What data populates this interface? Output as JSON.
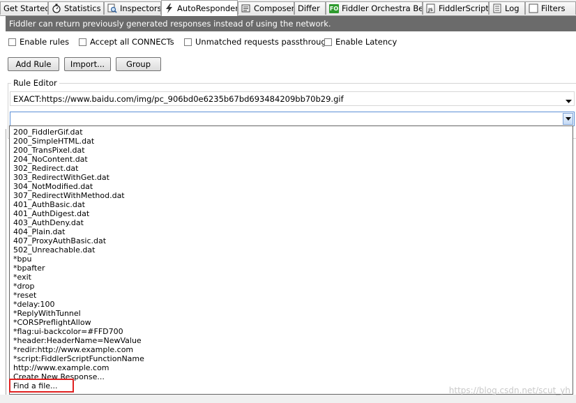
{
  "tabs": [
    {
      "label": "Get Started",
      "icon": ""
    },
    {
      "label": "Statistics",
      "icon": "stopwatch-icon"
    },
    {
      "label": "Inspectors",
      "icon": "inspect-icon"
    },
    {
      "label": "AutoResponder",
      "icon": "lightning-icon",
      "active": true
    },
    {
      "label": "Composer",
      "icon": "composer-icon"
    },
    {
      "label": "Differ",
      "icon": ""
    },
    {
      "label": "Fiddler Orchestra Beta",
      "icon": "fo-icon",
      "badge": "FO"
    },
    {
      "label": "FiddlerScript",
      "icon": "script-icon",
      "badge": "JS"
    },
    {
      "label": "Log",
      "icon": "log-icon"
    },
    {
      "label": "Filters",
      "icon": "filter-checkbox"
    }
  ],
  "info_bar": "Fiddler can return previously generated responses instead of using the network.",
  "options": {
    "enable_rules": "Enable rules",
    "accept_connects": "Accept all CONNECTs",
    "unmatched_passthrough": "Unmatched requests passthrough",
    "enable_latency": "Enable Latency"
  },
  "buttons": {
    "add_rule": "Add Rule",
    "import": "Import...",
    "group": "Group"
  },
  "rule_editor": {
    "title": "Rule Editor",
    "match_value": "EXACT:https://www.baidu.com/img/pc_906bd0e6235b67bd693484209bb70b29.gif",
    "action_value": ""
  },
  "dropdown_items": [
    "200_FiddlerGif.dat",
    "200_SimpleHTML.dat",
    "200_TransPixel.dat",
    "204_NoContent.dat",
    "302_Redirect.dat",
    "303_RedirectWithGet.dat",
    "304_NotModified.dat",
    "307_RedirectWithMethod.dat",
    "401_AuthBasic.dat",
    "401_AuthDigest.dat",
    "403_AuthDeny.dat",
    "404_Plain.dat",
    "407_ProxyAuthBasic.dat",
    "502_Unreachable.dat",
    "*bpu",
    "*bpafter",
    "*exit",
    "*drop",
    "*reset",
    "*delay:100",
    "*ReplyWithTunnel",
    "*CORSPreflightAllow",
    "*flag:ui-backcolor=#FFD700",
    "*header:HeaderName=NewValue",
    "*redir:http://www.example.com",
    "*script:FiddlerScriptFunctionName",
    "http://www.example.com",
    "Create New Response...",
    "Find a file..."
  ],
  "highlighted_item": "Find a file...",
  "watermark": "https://blog.csdn.net/scut_yh",
  "colors": {
    "info_bar_bg": "#6b6b6b",
    "highlight_border": "#e02020",
    "dropdown_accent": "#5b8fd6"
  }
}
